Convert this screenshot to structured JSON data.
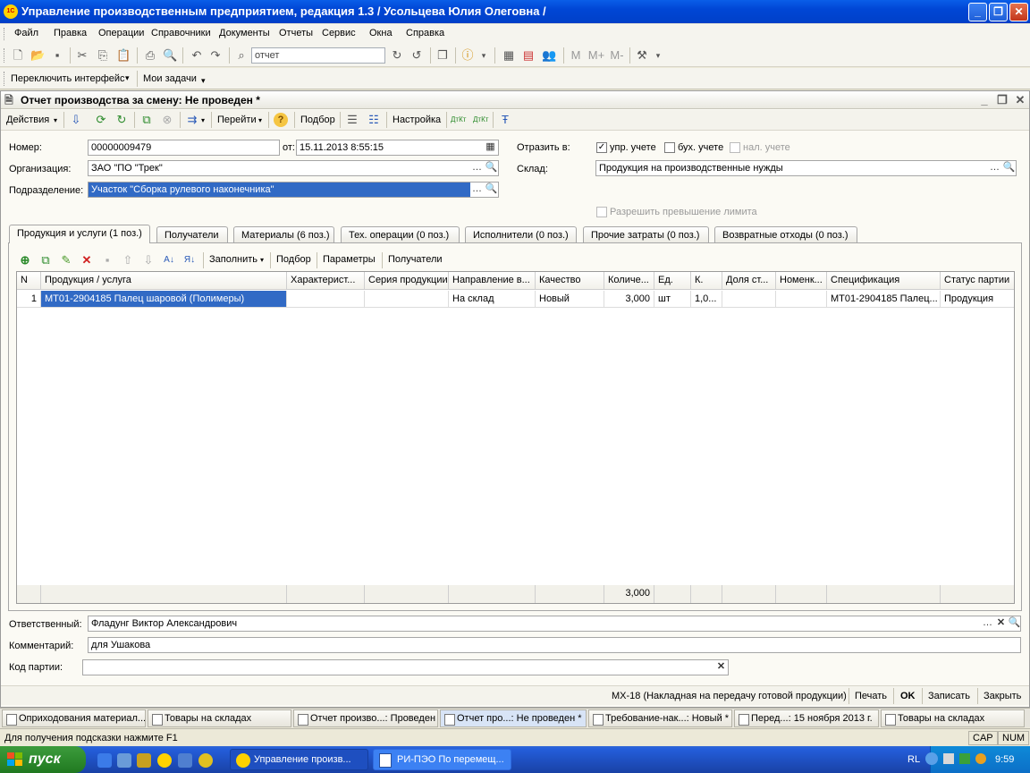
{
  "app": {
    "title": "Управление производственным предприятием, редакция 1.3 / Усольцева Юлия Олеговна /"
  },
  "menu": [
    "Файл",
    "Правка",
    "Операции",
    "Справочники",
    "Документы",
    "Отчеты",
    "Сервис",
    "Окна",
    "Справка"
  ],
  "toolbar": {
    "search_value": "отчет",
    "switch_interface": "Переключить интерфейс",
    "my_tasks": "Мои задачи",
    "m": "M",
    "m_plus": "M+",
    "m_minus": "M-"
  },
  "document": {
    "title": "Отчет производства за смену: Не проведен *",
    "actions": "Действия",
    "goto": "Перейти",
    "selection": "Подбор",
    "settings": "Настройка"
  },
  "form": {
    "number_label": "Номер:",
    "number": "00000009479",
    "date_label": "от:",
    "date": "15.11.2013  8:55:15",
    "org_label": "Организация:",
    "org": "ЗАО \"ПО \"Трек\"",
    "dept_label": "Подразделение:",
    "dept": "Участок \"Сборка рулевого наконечника\"",
    "reflect_label": "Отразить в:",
    "upr": "упр. учете",
    "buh": "бух. учете",
    "nal": "нал. учете",
    "warehouse_label": "Склад:",
    "warehouse": "Продукция на производственные нужды",
    "allow_limit": "Разрешить превышение лимита"
  },
  "tabs": [
    "Продукция и услуги (1 поз.)",
    "Получатели",
    "Материалы (6 поз.)",
    "Тех. операции (0 поз.)",
    "Исполнители (0 поз.)",
    "Прочие затраты (0 поз.)",
    "Возвратные отходы (0 поз.)"
  ],
  "grid_toolbar": {
    "fill": "Заполнить",
    "selection": "Подбор",
    "params": "Параметры",
    "recipients": "Получатели"
  },
  "table": {
    "headers": [
      "N",
      "Продукция / услуга",
      "Характерист...",
      "Серия продукции",
      "Направление в...",
      "Качество",
      "Количе...",
      "Ед.",
      "К.",
      "Доля ст...",
      "Номенк...",
      "Спецификация",
      "Статус партии"
    ],
    "rows": [
      [
        "1",
        "МТ01-2904185 Палец шаровой (Полимеры)",
        "",
        "",
        "На склад",
        "Новый",
        "3,000",
        "шт",
        "1,0...",
        "",
        "",
        "МТ01-2904185 Палец...",
        "Продукция"
      ]
    ],
    "total_qty": "3,000"
  },
  "footer": {
    "resp_label": "Ответственный:",
    "resp": "Фладунг Виктор Александрович",
    "comment_label": "Комментарий:",
    "comment": "для Ушакова",
    "lot_label": "Код партии:",
    "lot": ""
  },
  "bottom": {
    "mx18": "МХ-18 (Накладная на передачу готовой продукции)",
    "print": "Печать",
    "ok": "OK",
    "save": "Записать",
    "close": "Закрыть"
  },
  "windows": [
    "Оприходования материал...",
    "Товары на складах",
    "Отчет произво...: Проведен",
    "Отчет про...: Не проведен *",
    "Требование-нак...: Новый *",
    "Перед...: 15 ноября 2013 г.",
    "Товары на складах"
  ],
  "status": {
    "hint": "Для получения подсказки нажмите F1",
    "cap": "CAP",
    "num": "NUM"
  },
  "taskbar": {
    "start": "пуск",
    "btn1": "Управление произв...",
    "btn2": "РИ-ПЭО По перемещ...",
    "lang": "RL",
    "time": "9:59"
  }
}
